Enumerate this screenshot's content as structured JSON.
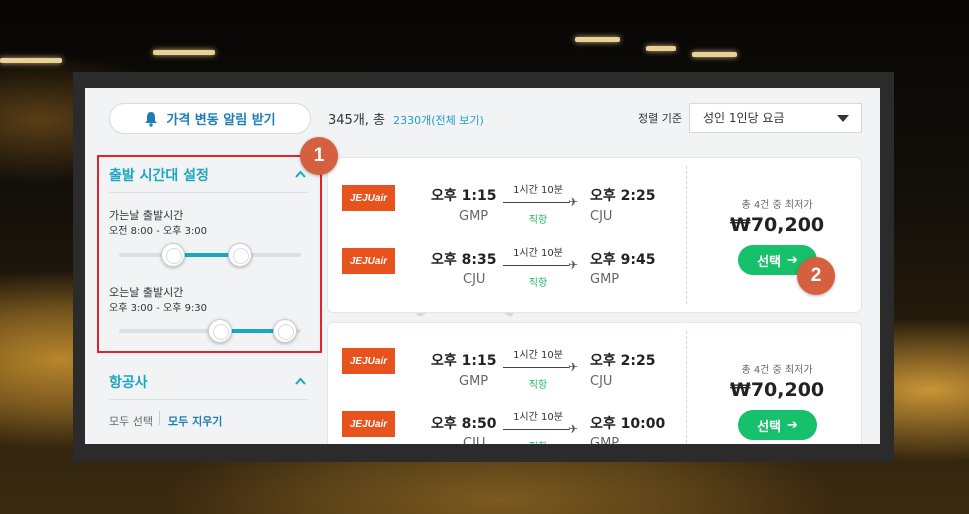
{
  "toolbar": {
    "alert_label": "가격 변동 알림 받기",
    "count_text": "345개, 총",
    "count_link": "2330개(전체 보기)",
    "sort_label": "정렬 기준",
    "sort_value": "성인 1인당 요금"
  },
  "filters": {
    "time_title": "출발 시간대 설정",
    "outbound_label": "가는날 출발시간",
    "outbound_range": "오전 8:00 - 오후 3:00",
    "inbound_label": "오는날 출발시간",
    "inbound_range": "오후 3:00 - 오후 9:30",
    "airline_title": "항공사",
    "select_all": "모두 선택",
    "clear_all": "모두 지우기"
  },
  "results": [
    {
      "legs": [
        {
          "airline": "JEJUair",
          "dep_time": "오후 1:15",
          "dep_code": "GMP",
          "duration": "1시간 10분",
          "type": "직항",
          "arr_time": "오후 2:25",
          "arr_code": "CJU"
        },
        {
          "airline": "JEJUair",
          "dep_time": "오후 8:35",
          "dep_code": "CJU",
          "duration": "1시간 10분",
          "type": "직항",
          "arr_time": "오후 9:45",
          "arr_code": "GMP"
        }
      ],
      "price_caption": "총 4건 중 최저가",
      "price": "₩70,200",
      "select_label": "선택"
    },
    {
      "legs": [
        {
          "airline": "JEJUair",
          "dep_time": "오후 1:15",
          "dep_code": "GMP",
          "duration": "1시간 10분",
          "type": "직항",
          "arr_time": "오후 2:25",
          "arr_code": "CJU"
        },
        {
          "airline": "JEJUair",
          "dep_time": "오후 8:50",
          "dep_code": "CJU",
          "duration": "1시간 10분",
          "type": "직항",
          "arr_time": "오후 10:00",
          "arr_code": "GMP"
        }
      ],
      "price_caption": "총 4건 중 최저가",
      "price": "₩70,200",
      "select_label": "선택"
    }
  ],
  "markers": [
    "1",
    "2"
  ],
  "colors": {
    "accent": "#1aa7c4",
    "highlight_border": "#e0232a",
    "select_button": "#17c06a",
    "marker": "#d4603f",
    "airline_logo": "#e8531d"
  }
}
